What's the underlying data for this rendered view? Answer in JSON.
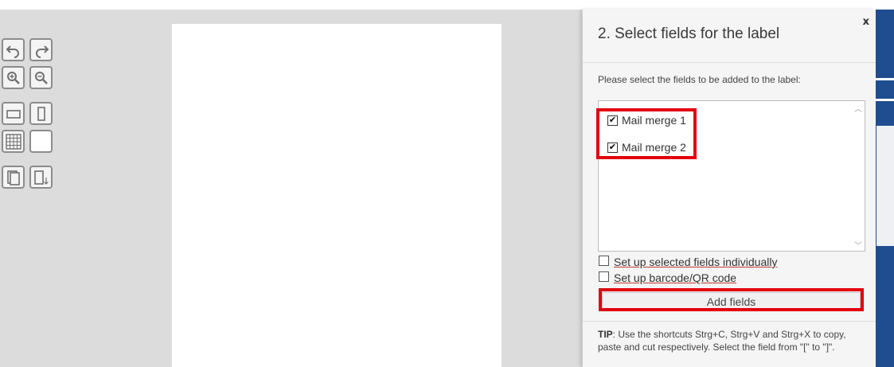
{
  "dialog": {
    "title": "2. Select fields for the label",
    "close_label": "x",
    "instruction": "Please select the fields to be added to the label:",
    "fields": [
      {
        "label": "Mail merge 1",
        "checked": true
      },
      {
        "label": "Mail merge 2",
        "checked": true
      }
    ],
    "options": [
      {
        "label": "Set up selected fields individually",
        "checked": false
      },
      {
        "label": "Set up barcode/QR code",
        "checked": false
      }
    ],
    "add_button_label": "Add fields",
    "tip_prefix": "TIP",
    "tip_text": ": Use the shortcuts Strg+C, Strg+V and Strg+X to copy, paste and cut respectively. Select the field from \"[\" to \"]\".",
    "checkmark_glyph": "✔",
    "scroll_up_glyph": "︿",
    "scroll_down_glyph": "﹀"
  },
  "toolbar": {
    "buttons": [
      "undo-icon",
      "redo-icon",
      "zoom-in-icon",
      "zoom-out-icon",
      "landscape-icon",
      "portrait-icon",
      "grid-icon",
      "blank-page-icon",
      "copy-page-icon",
      "page-down-icon"
    ]
  },
  "colors": {
    "highlight": "#e3000f",
    "brand_blue": "#1f4d8f"
  }
}
